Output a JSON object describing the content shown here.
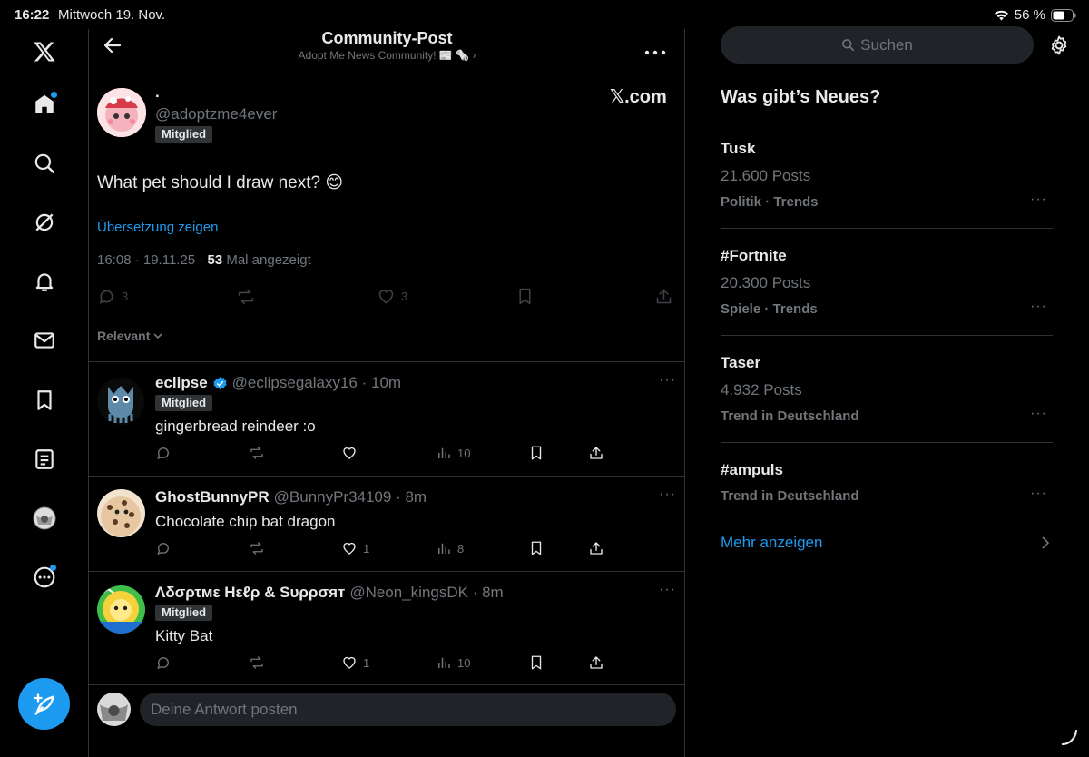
{
  "status": {
    "time": "16:22",
    "date": "Mittwoch 19. Nov.",
    "battery": "56 %"
  },
  "header": {
    "title": "Community-Post",
    "subtitle": "Adopt Me News Community! 📰 🗞️ ›"
  },
  "post": {
    "name": ".",
    "handle": "@adoptzme4ever",
    "badge": "Mitglied",
    "watermark": "𝕏.com",
    "text": "What pet should I draw next? 😊",
    "translate": "Übersetzung zeigen",
    "meta_prefix": "16:08 · 19.11.25 · ",
    "views": "53",
    "views_suffix": " Mal angezeigt",
    "replies": "3",
    "likes": "3"
  },
  "sort": {
    "label": "Relevant"
  },
  "replies": [
    {
      "name": "eclipse",
      "handle": "@eclipsegalaxy16 · 10m",
      "badge": "Mitglied",
      "text": "gingerbread reindeer :o",
      "likes": "",
      "views": "10"
    },
    {
      "name": "GhostBunnyPR",
      "handle": "@BunnyPr34109 · 8m",
      "badge": "",
      "text": "Chocolate chip bat dragon",
      "likes": "1",
      "views": "8"
    },
    {
      "name": "Λδσρτмε Hεℓρ & Sυρρσят",
      "handle": "@Neon_kingsDK · 8m",
      "badge": "Mitglied",
      "text": "Kitty Bat",
      "likes": "1",
      "views": "10"
    }
  ],
  "composer": {
    "placeholder": "Deine Antwort posten"
  },
  "sidebar": {
    "search_placeholder": "Suchen",
    "heading": "Was gibt’s Neues?",
    "trends": [
      {
        "title": "Tusk",
        "count": "21.600 Posts",
        "category": "Politik · Trends"
      },
      {
        "title": "#Fortnite",
        "count": "20.300 Posts",
        "category": "Spiele · Trends"
      },
      {
        "title": "Taser",
        "count": "4.932 Posts",
        "category": "Trend in Deutschland"
      },
      {
        "title": "#ampuls",
        "count": "",
        "category": "Trend in Deutschland"
      }
    ],
    "show_more": "Mehr anzeigen"
  },
  "colors": {
    "accent": "#1d9bf0",
    "background": "#000000",
    "border": "#2f3336",
    "muted": "#71767b"
  }
}
